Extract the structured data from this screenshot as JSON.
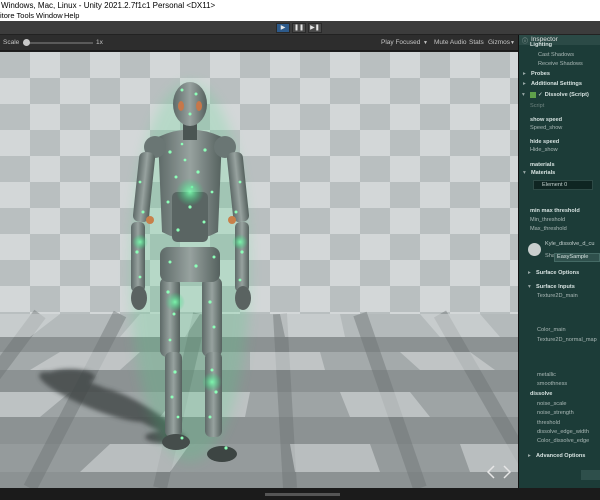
{
  "window": {
    "title": "Windows, Mac, Linux - Unity 2021.2.7f1c1 Personal <DX11>"
  },
  "menu": {
    "items": [
      "itore Tools",
      "Window",
      "Help"
    ]
  },
  "toolbar": {
    "play_icon": "play-icon",
    "pause_icon": "pause-icon",
    "step_icon": "step-icon",
    "accent": "#2d5a8a"
  },
  "game_view": {
    "scale_label": "Scale",
    "scale_value": "1x",
    "play_focused": "Play Focused",
    "mute_audio": "Mute Audio",
    "stats": "Stats",
    "gizmos": "Gizmos"
  },
  "inspector": {
    "tab_label": "Inspector",
    "rows": [
      {
        "text": "Lighting",
        "kind": "section"
      },
      {
        "text": "Cast Shadows",
        "kind": "field"
      },
      {
        "text": "Receive Shadows",
        "kind": "field"
      },
      {
        "text": "Probes",
        "kind": "section"
      },
      {
        "text": "Additional Settings",
        "kind": "section"
      },
      {
        "text": "Dissolve (Script)",
        "kind": "component"
      },
      {
        "text": "Script",
        "kind": "field"
      },
      {
        "text": "show speed",
        "kind": "header"
      },
      {
        "text": "Speed_show",
        "kind": "field"
      },
      {
        "text": "hide speed",
        "kind": "header"
      },
      {
        "text": "Hide_show",
        "kind": "field"
      },
      {
        "text": "materials",
        "kind": "header"
      },
      {
        "text": "Materials",
        "kind": "section"
      },
      {
        "text": "Element 0",
        "kind": "element"
      },
      {
        "text": "min max threshold",
        "kind": "header"
      },
      {
        "text": "Min_threshold",
        "kind": "field"
      },
      {
        "text": "Max_threshold",
        "kind": "field"
      },
      {
        "text": "Kyle_dissolve_d_cu",
        "kind": "material"
      },
      {
        "text": "Shader",
        "kind": "field"
      },
      {
        "text": "Surface Options",
        "kind": "section"
      },
      {
        "text": "Surface Inputs",
        "kind": "section"
      },
      {
        "text": "Texture2D_main",
        "kind": "field"
      },
      {
        "text": "Color_main",
        "kind": "field"
      },
      {
        "text": "Texture2D_normal_map",
        "kind": "field"
      },
      {
        "text": "metallic",
        "kind": "field"
      },
      {
        "text": "smoothness",
        "kind": "field"
      },
      {
        "text": "dissolve",
        "kind": "header"
      },
      {
        "text": "noise_scale",
        "kind": "field"
      },
      {
        "text": "noise_strength",
        "kind": "field"
      },
      {
        "text": "threshold",
        "kind": "field"
      },
      {
        "text": "dissolve_edge_width",
        "kind": "field"
      },
      {
        "text": "Color_dissolve_edge",
        "kind": "field"
      },
      {
        "text": "Advanced Options",
        "kind": "section"
      }
    ],
    "shader_value": "EasySample"
  },
  "colors": {
    "glow": "#55ff99",
    "robot_body": "#7b8784",
    "checker_light": "#d5d9da",
    "checker_dark": "#a8aeaf",
    "inspector_bg": "#1c3c38"
  }
}
